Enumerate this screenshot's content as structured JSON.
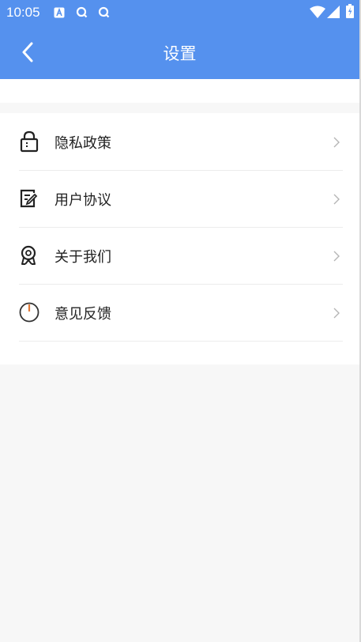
{
  "status_bar": {
    "time": "10:05",
    "notification_icons": [
      "a-icon",
      "search-circle-icon",
      "search-circle-icon"
    ],
    "system_icons": [
      "wifi-icon",
      "signal-icon",
      "battery-icon"
    ]
  },
  "header": {
    "title": "设置",
    "back_icon": "chevron-left-icon",
    "background_color": "#5591ee"
  },
  "settings_list": [
    {
      "label": "隐私政策",
      "icon": "lock-icon"
    },
    {
      "label": "用户协议",
      "icon": "agreement-edit-icon"
    },
    {
      "label": "关于我们",
      "icon": "about-badge-icon"
    },
    {
      "label": "意见反馈",
      "icon": "power-icon"
    }
  ]
}
